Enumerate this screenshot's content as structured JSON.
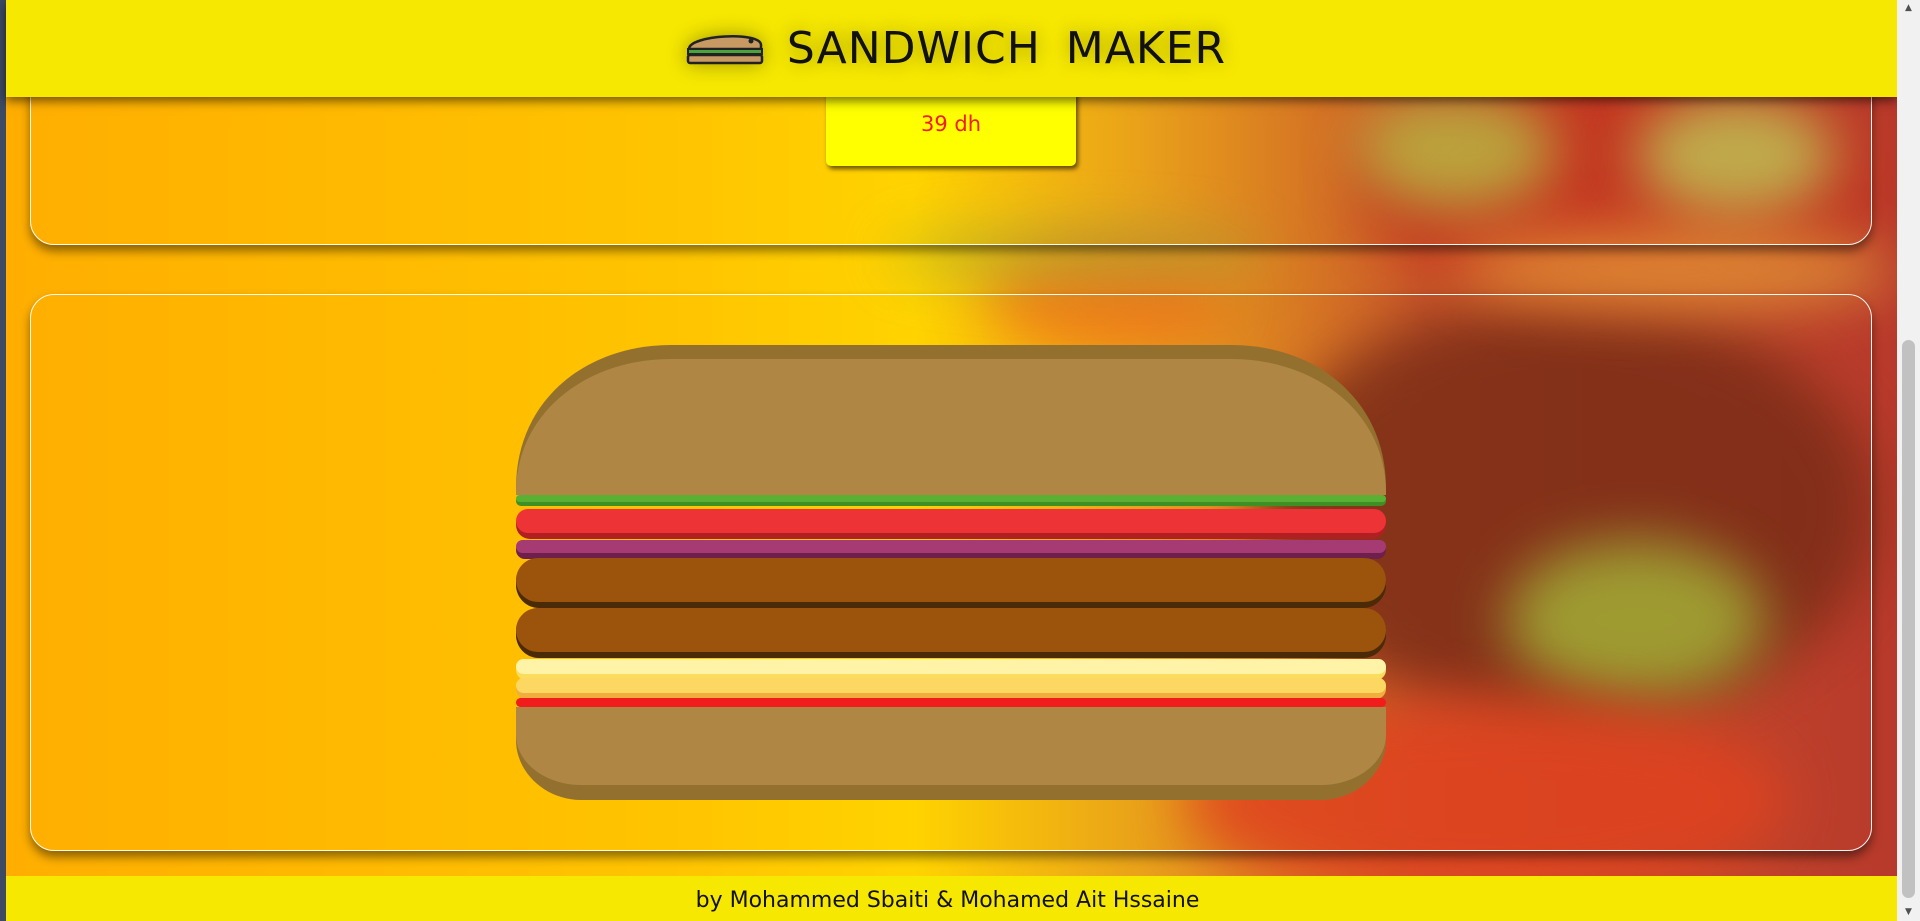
{
  "header": {
    "title": "SANDWICH  MAKER",
    "logo_icon": "sandwich-icon"
  },
  "price_card": {
    "price": "39 dh",
    "price_color": "#f11c1c",
    "background": "#ffff00"
  },
  "sandwich_preview": {
    "layers": [
      "bread-top",
      "lettuce",
      "tomato",
      "onion",
      "meat-patty",
      "meat-patty",
      "cheese",
      "cheese",
      "ketchup",
      "bread-bottom"
    ]
  },
  "footer": {
    "credits": "by Mohammed Sbaiti & Mohamed Ait Hssaine"
  },
  "colors": {
    "header_background": "#f6e800",
    "bread": "#b08645",
    "bread_shade": "#94702e",
    "lettuce": "#5ab032",
    "tomato": "#ee3337",
    "onion": "#a63b74",
    "meat": "#9c530c",
    "cheese": "#fbdc5d",
    "ketchup": "#f11c1c"
  }
}
